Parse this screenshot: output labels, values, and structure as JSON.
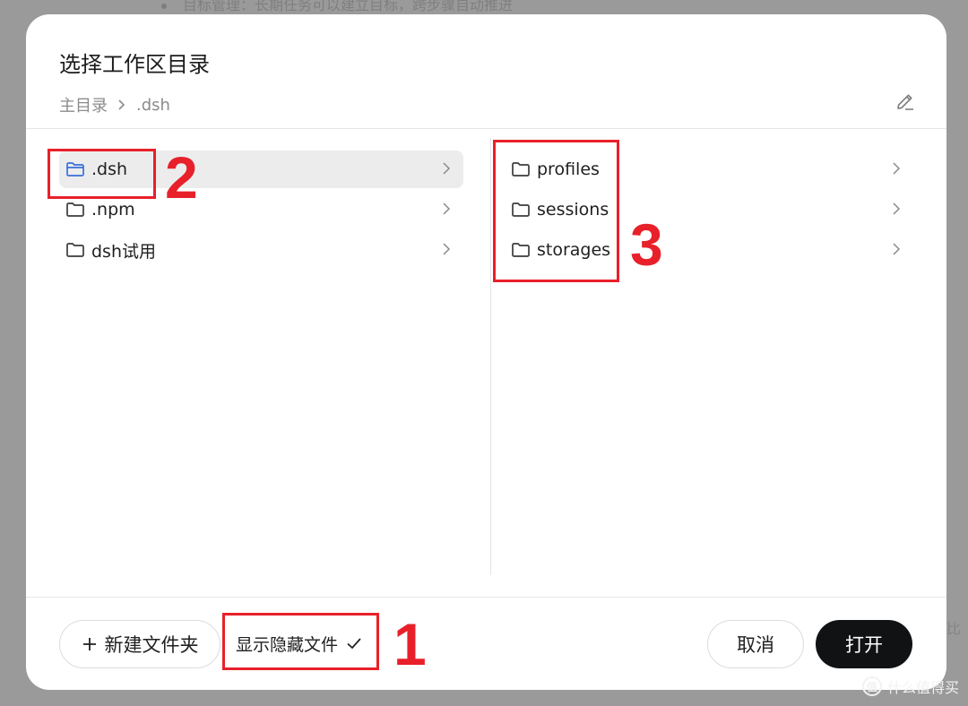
{
  "backdrop": {
    "top_text": "目标管理：长期任务可以建立目标，跨步骤自动推进",
    "right_fragment": "比"
  },
  "dialog": {
    "title": "选择工作区目录",
    "breadcrumb": [
      "主目录",
      ".dsh"
    ],
    "left_items": [
      {
        "label": ".dsh",
        "selected": true,
        "icon": "folder-open-icon"
      },
      {
        "label": ".npm",
        "selected": false,
        "icon": "folder-icon"
      },
      {
        "label": "dsh试用",
        "selected": false,
        "icon": "folder-icon"
      }
    ],
    "right_items": [
      {
        "label": "profiles",
        "icon": "folder-icon"
      },
      {
        "label": "sessions",
        "icon": "folder-icon"
      },
      {
        "label": "storages",
        "icon": "folder-icon"
      }
    ],
    "footer": {
      "new_folder": "新建文件夹",
      "show_hidden": "显示隐藏文件",
      "show_hidden_checked": true,
      "cancel": "取消",
      "open": "打开"
    },
    "accent_color": "#3a6fd8"
  },
  "annotations": [
    "1",
    "2",
    "3"
  ],
  "watermark": "什么值得买",
  "colors": {
    "annotation": "#e8202a",
    "primary_button": "#111214"
  }
}
